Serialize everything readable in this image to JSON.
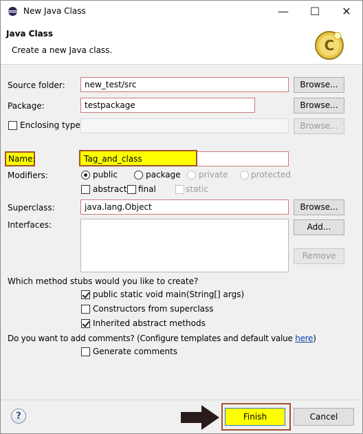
{
  "window": {
    "title": "New Java Class",
    "controls": {
      "minimize": "—",
      "maximize": "☐",
      "close": "✕"
    }
  },
  "header": {
    "title": "Java Class",
    "subtitle": "Create a new Java class."
  },
  "form": {
    "source_folder": {
      "label": "Source folder:",
      "value": "new_test/src"
    },
    "package": {
      "label": "Package:",
      "value": "testpackage"
    },
    "enclosing_type": {
      "label": "Enclosing type:",
      "value": ""
    },
    "name": {
      "label": "Name:",
      "value": "Tag_and_class"
    },
    "modifiers": {
      "label": "Modifiers:",
      "radios": [
        "public",
        "package",
        "private",
        "protected"
      ],
      "checks": [
        "abstract",
        "final",
        "static"
      ]
    },
    "superclass": {
      "label": "Superclass:",
      "value": "java.lang.Object"
    },
    "interfaces": {
      "label": "Interfaces:"
    }
  },
  "buttons": {
    "browse": "Browse...",
    "add": "Add...",
    "remove": "Remove",
    "finish": "Finish",
    "cancel": "Cancel"
  },
  "stubs": {
    "question": "Which method stubs would you like to create?",
    "options": [
      {
        "label": "public static void main(String[] args)",
        "checked": true
      },
      {
        "label": "Constructors from superclass",
        "checked": false
      },
      {
        "label": "Inherited abstract methods",
        "checked": true
      }
    ]
  },
  "comments": {
    "question": "Do you want to add comments? (Configure templates and default value ",
    "link": "here",
    "close_paren": ")",
    "option": "Generate comments"
  },
  "colors": {
    "highlight_yellow": "#ffff00",
    "annotation_border": "#a0522d",
    "arrow": "#2b1a1a"
  }
}
